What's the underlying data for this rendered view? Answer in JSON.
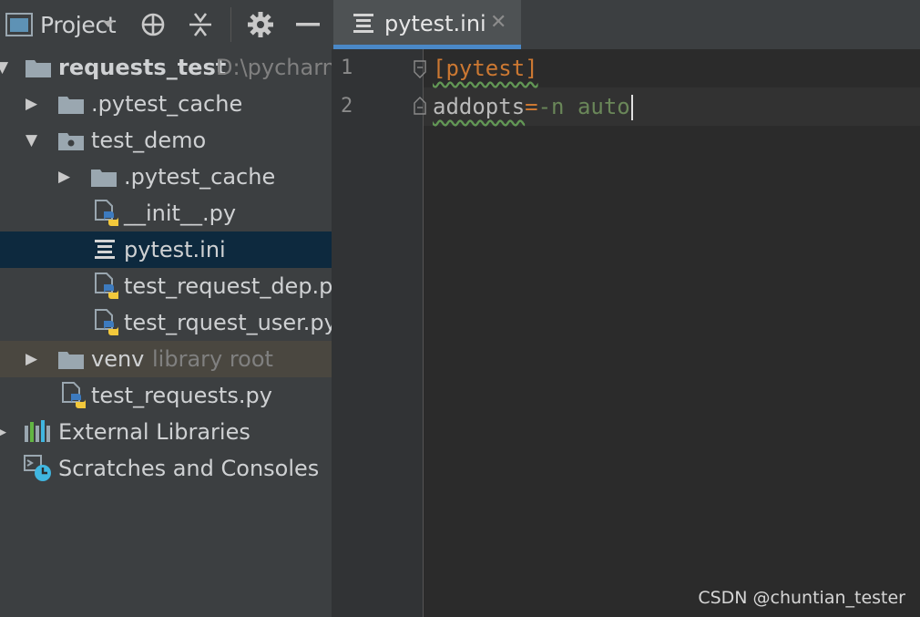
{
  "project_panel": {
    "title": "Project",
    "title_icon": "project-window-icon",
    "toolbar_icons": [
      "dropdown-arrow-icon",
      "locate-icon",
      "collapse-all-icon",
      "gear-icon",
      "minimize-icon"
    ]
  },
  "tree": {
    "root": {
      "name": "requests_test",
      "path": "D:\\pycharm"
    },
    "items": [
      {
        "label": ".pytest_cache",
        "icon": "folder-icon"
      },
      {
        "label": "test_demo",
        "icon": "package-folder-icon"
      },
      {
        "label": ".pytest_cache",
        "icon": "folder-icon"
      },
      {
        "label": "__init__.py",
        "icon": "python-file-icon"
      },
      {
        "label": "pytest.ini",
        "icon": "ini-file-icon"
      },
      {
        "label": "test_request_dep.py",
        "icon": "python-file-icon"
      },
      {
        "label": "test_rquest_user.py",
        "icon": "python-file-icon"
      },
      {
        "label": "venv",
        "suffix": "library root",
        "icon": "folder-icon"
      },
      {
        "label": "test_requests.py",
        "icon": "python-file-icon"
      },
      {
        "label": "External Libraries",
        "icon": "libraries-icon"
      },
      {
        "label": "Scratches and Consoles",
        "icon": "scratches-icon"
      }
    ]
  },
  "editor": {
    "tab": {
      "label": "pytest.ini",
      "close": "✕"
    },
    "line_numbers": [
      "1",
      "2"
    ],
    "lines": [
      {
        "section": "[pytest]"
      },
      {
        "key": "addopts",
        "eq": "=",
        "value": "-n auto"
      }
    ]
  },
  "watermark": "CSDN @chuntian_tester",
  "colors": {
    "panel_bg": "#3c3f41",
    "editor_bg": "#2b2b2b",
    "selection": "#0d293e",
    "tab_accent": "#4a88c7",
    "keyword_orange": "#cc7832",
    "string_green": "#6a8759"
  }
}
